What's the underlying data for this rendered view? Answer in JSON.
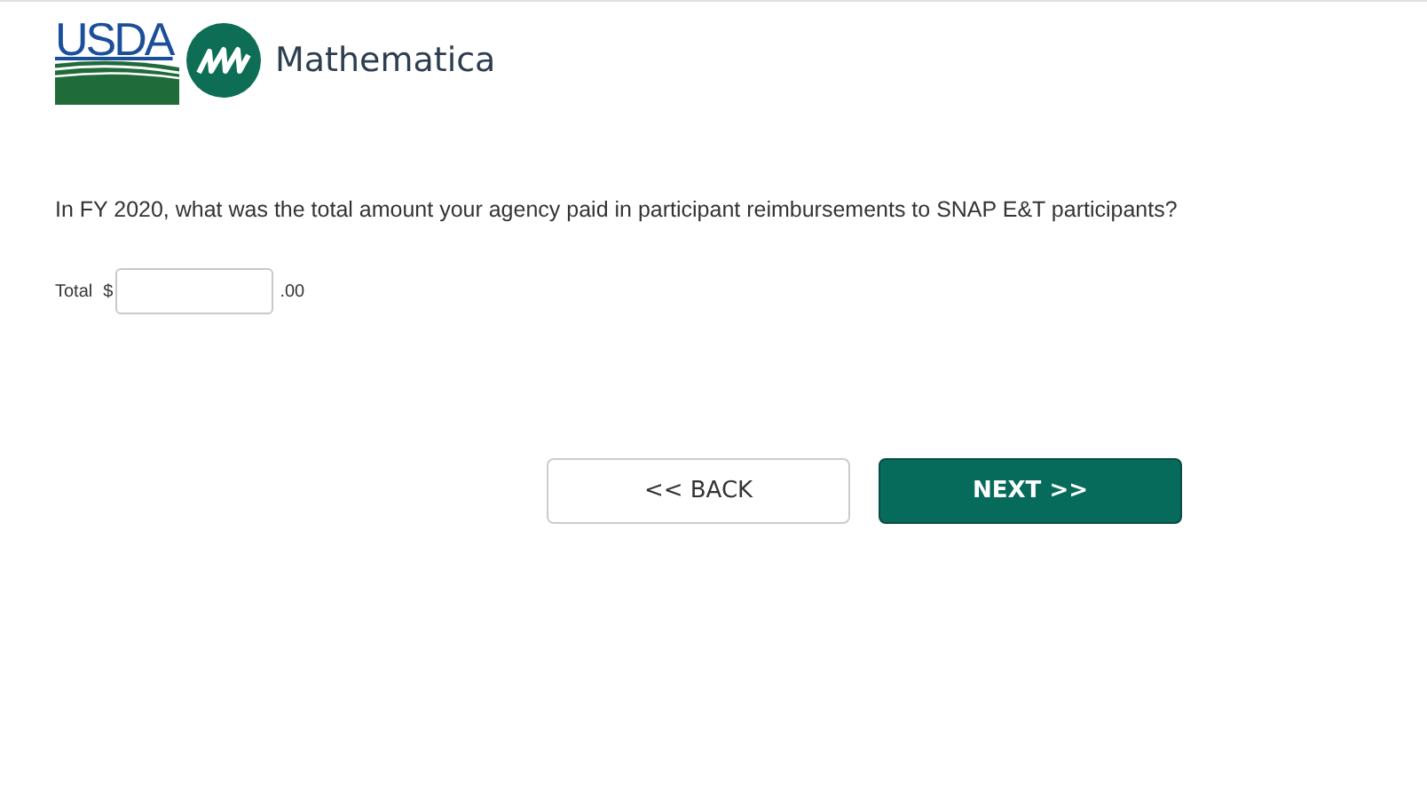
{
  "header": {
    "agency_logo_text": "USDA",
    "partner_logo_text": "Mathematica"
  },
  "question": {
    "text": "In FY 2020, what was the total amount your agency paid in participant reimbursements to SNAP E&T participants?"
  },
  "amount_field": {
    "label": "Total",
    "prefix": "$",
    "suffix": ".00"
  },
  "buttons": [
    {
      "kind": "secondary",
      "label": "<< BACK"
    },
    {
      "kind": "primary",
      "label": "NEXT >>"
    }
  ]
}
